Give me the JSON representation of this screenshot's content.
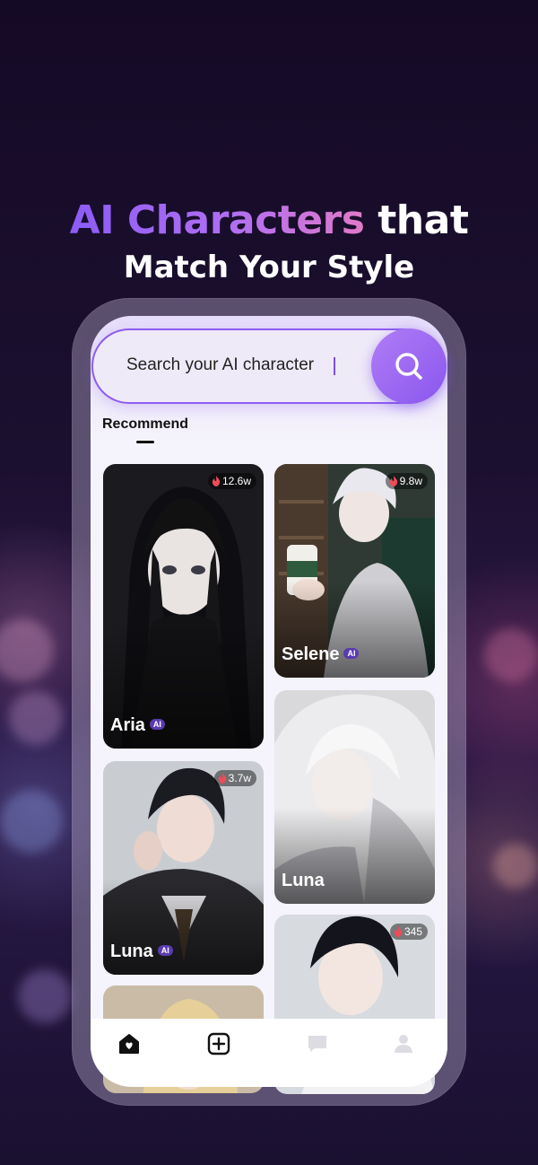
{
  "headline": {
    "line1_gradient": "AI Characters",
    "line1_white": "that",
    "line2": "Match Your Style"
  },
  "search": {
    "placeholder": "Search your AI character"
  },
  "tabs": [
    {
      "label": "Recommend",
      "active": true
    }
  ],
  "cards": [
    {
      "name": "Aria",
      "badge": "AI",
      "count": "12.6w"
    },
    {
      "name": "Selene",
      "badge": "AI",
      "count": "9.8w"
    },
    {
      "name": "Luna",
      "badge": "AI",
      "count": "3.7w"
    },
    {
      "name": "Luna",
      "badge": "",
      "count": ""
    },
    {
      "name": "",
      "badge": "",
      "count": "345"
    },
    {
      "name": "",
      "badge": "",
      "count": ""
    }
  ],
  "bottom_nav": [
    {
      "icon": "home-heart-icon",
      "active": true
    },
    {
      "icon": "add-square-icon",
      "active": true
    },
    {
      "icon": "chat-icon",
      "active": false
    },
    {
      "icon": "profile-icon",
      "active": false
    }
  ],
  "colors": {
    "accent_purple": "#8f5cf0",
    "gradient_pink": "#e07ac8",
    "background_dark": "#1c1030",
    "ai_badge": "#5a3bb0"
  }
}
